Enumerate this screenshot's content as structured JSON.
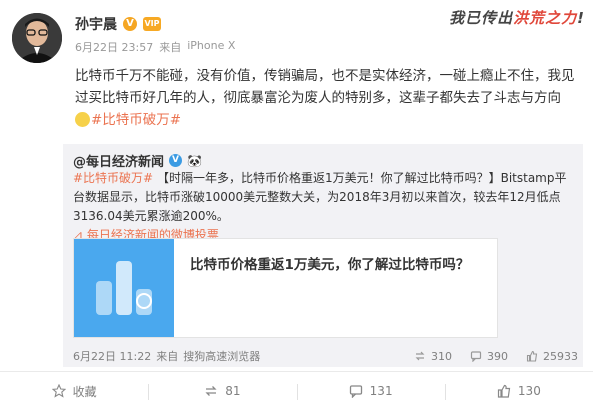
{
  "watermark": {
    "prefix": "我已传出",
    "highlight": "洪荒之力",
    "suffix": "!"
  },
  "header": {
    "author": "孙宇晨",
    "verified_glyph": "V",
    "vip_label": "VIP",
    "date": "6月22日 23:57",
    "source_prefix": "来自",
    "source": "iPhone X"
  },
  "post": {
    "text_1": "比特币千万不能碰，没有价值，传销骗局，也不是实体经济，一碰上瘾止不住，我见过买比特币好几年的人，彻底暴富沦为废人的特别多，这辈子都失去了斗志与方向",
    "hashtag": "#比特币破万#"
  },
  "repost": {
    "author": "@每日经济新闻",
    "verified_glyph": "V",
    "hashtag": "#比特币破万#",
    "text": "【时隔一年多，比特币价格重返1万美元！你了解过比特币吗？】Bitstamp平台数据显示，比特币涨破10000美元整数大关，为2018年3月初以来首次，较去年12月低点3136.04美元累涨逾200%。",
    "poll_link": "每日经济新闻的微博投票",
    "card_title": "比特币价格重返1万美元，你了解过比特币吗？",
    "date": "6月22日 11:22",
    "source_prefix": "来自",
    "source": "搜狗高速浏览器",
    "reposts": "310",
    "comments": "390",
    "likes": "25933",
    "icons": {
      "repost": "repost-icon",
      "comment": "comment-icon",
      "like": "like-icon",
      "poll": "poll-icon"
    }
  },
  "actions": {
    "favorite": "收藏",
    "repost": "81",
    "comment": "131",
    "like": "130"
  },
  "colors": {
    "accent": "#eb7350",
    "card_blue": "#4aa8ee",
    "repost_bg": "#f2f2f5"
  }
}
